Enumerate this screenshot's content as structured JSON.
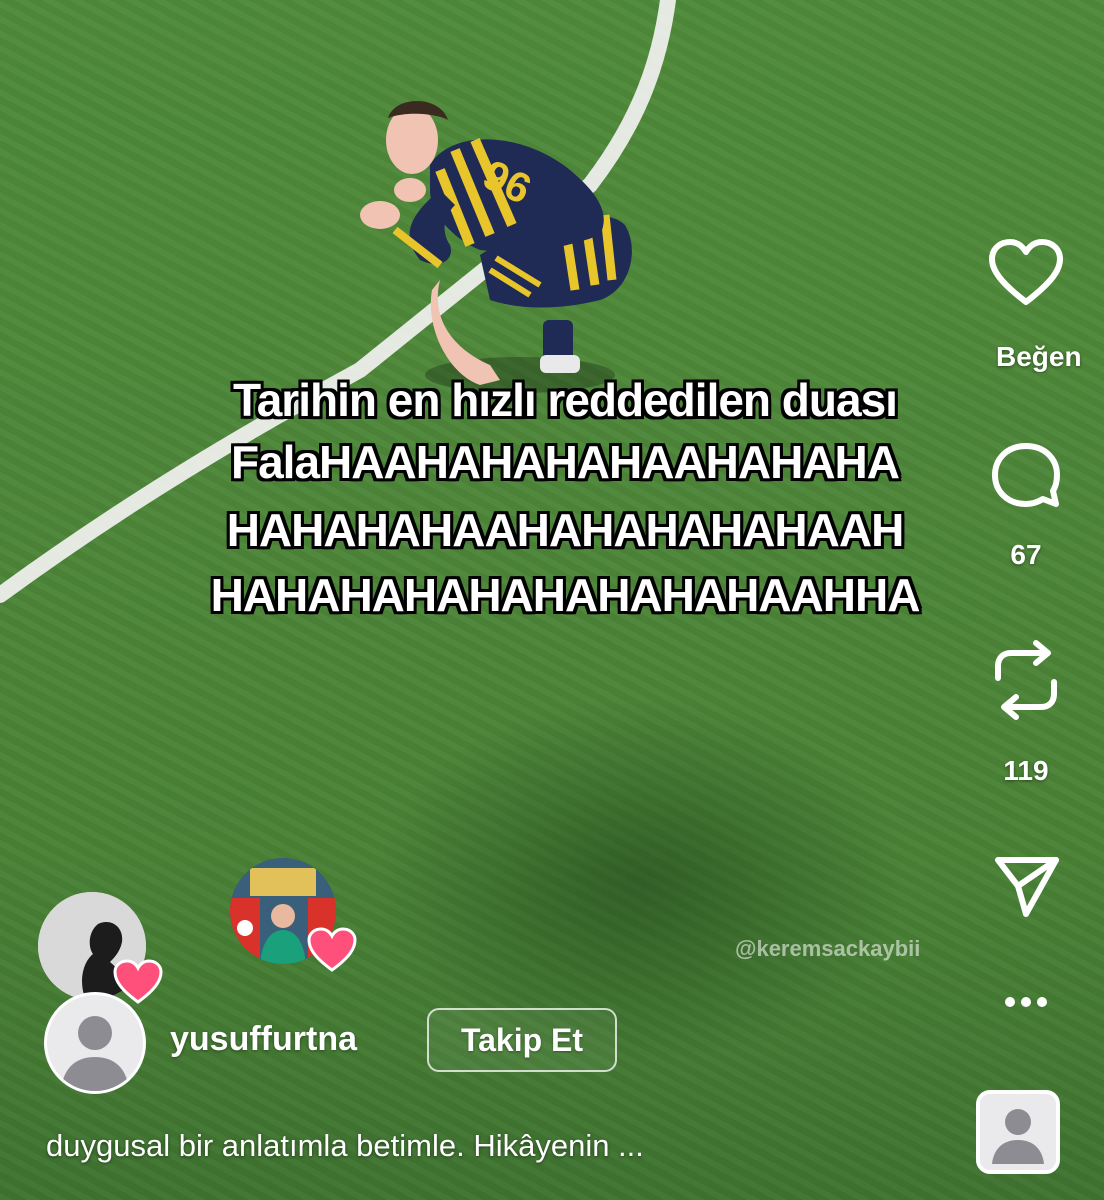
{
  "overlay": {
    "line1": "Tarihin en hızlı reddedilen duası",
    "line2": "FalaHAAHAHAHAHAAHAHAHA",
    "line3": "HAHAHAHAAHAHAHAHAHAAH",
    "line4": "HAHAHAHAHAHAHAHAHAAHHA"
  },
  "watermark": "@keremsackaybii",
  "actions": {
    "like_label": "Beğen",
    "comment_count": "67",
    "repost_count": "119"
  },
  "author": {
    "username": "yusuffurtna",
    "follow_label": "Takip Et"
  },
  "caption": "duygusal bir anlatımla betimle. Hikâyenin ...",
  "icons": {
    "like": "heart-outline-icon",
    "comment": "comment-bubble-icon",
    "repost": "repost-icon",
    "share": "send-icon",
    "more": "more-dots-icon",
    "reaction": "heart-filled-icon",
    "avatar": "default-avatar-icon"
  },
  "colors": {
    "pitch": "#4a8236",
    "jersey_navy": "#1f2a55",
    "jersey_yellow": "#e8c52a",
    "heart_pink": "#ff4f7b"
  }
}
